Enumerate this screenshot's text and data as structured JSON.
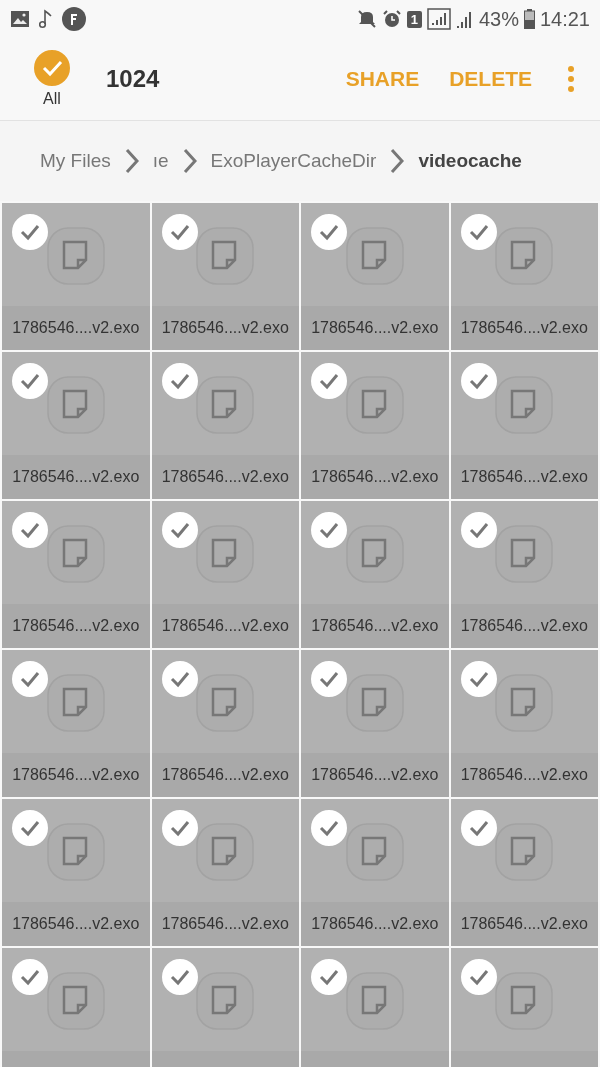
{
  "status_bar": {
    "sim": "1",
    "battery": "43%",
    "time": "14:21"
  },
  "header": {
    "select_all": {
      "label": "All",
      "checked": true
    },
    "count": "1024",
    "actions": [
      "SHARE",
      "DELETE"
    ]
  },
  "breadcrumb": [
    {
      "label": "My Files",
      "current": false
    },
    {
      "label": "ıe",
      "current": false
    },
    {
      "label": "ExoPlayerCacheDir",
      "current": false
    },
    {
      "label": "videocache",
      "current": true
    }
  ],
  "files": [
    {
      "name": "1786546....v2.exo",
      "checked": true
    },
    {
      "name": "1786546....v2.exo",
      "checked": true
    },
    {
      "name": "1786546....v2.exo",
      "checked": true
    },
    {
      "name": "1786546....v2.exo",
      "checked": true
    },
    {
      "name": "1786546....v2.exo",
      "checked": true
    },
    {
      "name": "1786546....v2.exo",
      "checked": true
    },
    {
      "name": "1786546....v2.exo",
      "checked": true
    },
    {
      "name": "1786546....v2.exo",
      "checked": true
    },
    {
      "name": "1786546....v2.exo",
      "checked": true
    },
    {
      "name": "1786546....v2.exo",
      "checked": true
    },
    {
      "name": "1786546....v2.exo",
      "checked": true
    },
    {
      "name": "1786546....v2.exo",
      "checked": true
    },
    {
      "name": "1786546....v2.exo",
      "checked": true
    },
    {
      "name": "1786546....v2.exo",
      "checked": true
    },
    {
      "name": "1786546....v2.exo",
      "checked": true
    },
    {
      "name": "1786546....v2.exo",
      "checked": true
    },
    {
      "name": "1786546....v2.exo",
      "checked": true
    },
    {
      "name": "1786546....v2.exo",
      "checked": true
    },
    {
      "name": "1786546....v2.exo",
      "checked": true
    },
    {
      "name": "1786546....v2.exo",
      "checked": true
    },
    {
      "checked": true
    },
    {
      "checked": true
    },
    {
      "checked": true
    },
    {
      "checked": true
    }
  ]
}
